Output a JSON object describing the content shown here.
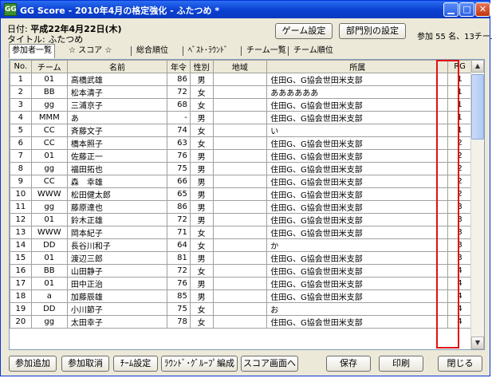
{
  "window": {
    "title": "GG Score - 2010年4月の格定強化 - ふたつめ *",
    "app_icon": "GG"
  },
  "header": {
    "date_label": "日付:",
    "date_value": "平成22年4月22日(木)",
    "title_label": "タイトル:",
    "title_value": "ふたつめ",
    "game_settings": "ゲーム設定",
    "dept_settings": "部門別の設定",
    "participants": "参加 55 名、13チーム"
  },
  "tabs": [
    "参加者一覧",
    "☆ スコア ☆",
    "総合順位",
    "ﾍﾞｽﾄ･ﾗｳﾝﾄﾞ",
    "チーム一覧",
    "チーム順位"
  ],
  "table": {
    "columns": [
      "No.",
      "チーム",
      "名前",
      "年令",
      "性別",
      "地域",
      "所属",
      "RG"
    ],
    "rows": [
      [
        "1",
        "01",
        "高橋武雄",
        "86",
        "男",
        "",
        "住田G、G協会世田米支部",
        "1"
      ],
      [
        "2",
        "BB",
        "松本清子",
        "72",
        "女",
        "",
        "ああああああ",
        "1"
      ],
      [
        "3",
        "gg",
        "三浦京子",
        "68",
        "女",
        "",
        "住田G、G協会世田米支部",
        "1"
      ],
      [
        "4",
        "MMM",
        "あ",
        "-",
        "男",
        "",
        "住田G、G協会世田米支部",
        "1"
      ],
      [
        "5",
        "CC",
        "斉藤文子",
        "74",
        "女",
        "",
        "い",
        "1"
      ],
      [
        "6",
        "CC",
        "橋本照子",
        "63",
        "女",
        "",
        "住田G、G協会世田米支部",
        "2"
      ],
      [
        "7",
        "01",
        "佐藤正一",
        "76",
        "男",
        "",
        "住田G、G協会世田米支部",
        "2"
      ],
      [
        "8",
        "gg",
        "福田拓也",
        "75",
        "男",
        "",
        "住田G、G協会世田米支部",
        "2"
      ],
      [
        "9",
        "CC",
        "森　幸雄",
        "66",
        "男",
        "",
        "住田G、G協会世田米支部",
        "2"
      ],
      [
        "10",
        "WWW",
        "松田健太郎",
        "65",
        "男",
        "",
        "住田G、G協会世田米支部",
        "2"
      ],
      [
        "11",
        "gg",
        "藤原達也",
        "86",
        "男",
        "",
        "住田G、G協会世田米支部",
        "3"
      ],
      [
        "12",
        "01",
        "鈴木正雄",
        "72",
        "男",
        "",
        "住田G、G協会世田米支部",
        "3"
      ],
      [
        "13",
        "WWW",
        "岡本紀子",
        "71",
        "女",
        "",
        "住田G、G協会世田米支部",
        "3"
      ],
      [
        "14",
        "DD",
        "長谷川和子",
        "64",
        "女",
        "",
        "か",
        "3"
      ],
      [
        "15",
        "01",
        "渡辺三郎",
        "81",
        "男",
        "",
        "住田G、G協会世田米支部",
        "3"
      ],
      [
        "16",
        "BB",
        "山田静子",
        "72",
        "女",
        "",
        "住田G、G協会世田米支部",
        "4"
      ],
      [
        "17",
        "01",
        "田中正治",
        "76",
        "男",
        "",
        "住田G、G協会世田米支部",
        "4"
      ],
      [
        "18",
        "a",
        "加藤辰雄",
        "85",
        "男",
        "",
        "住田G、G協会世田米支部",
        "4"
      ],
      [
        "19",
        "DD",
        "小川節子",
        "75",
        "女",
        "",
        "お",
        "4"
      ],
      [
        "20",
        "gg",
        "太田幸子",
        "78",
        "女",
        "",
        "住田G、G協会世田米支部",
        "4"
      ]
    ]
  },
  "footer": {
    "add": "参加追加",
    "cancel": "参加取消",
    "team_settings": "ﾁｰﾑ設定",
    "group_edit": "ﾗｳﾝﾄﾞ･ｸﾞﾙｰﾌﾟ編成",
    "to_score": "スコア画面へ",
    "save": "保存",
    "print": "印刷",
    "close": "閉じる"
  },
  "colors": {
    "titlebar": "#0a3fd1",
    "highlight": "#e01010",
    "face": "#ece9d8"
  }
}
